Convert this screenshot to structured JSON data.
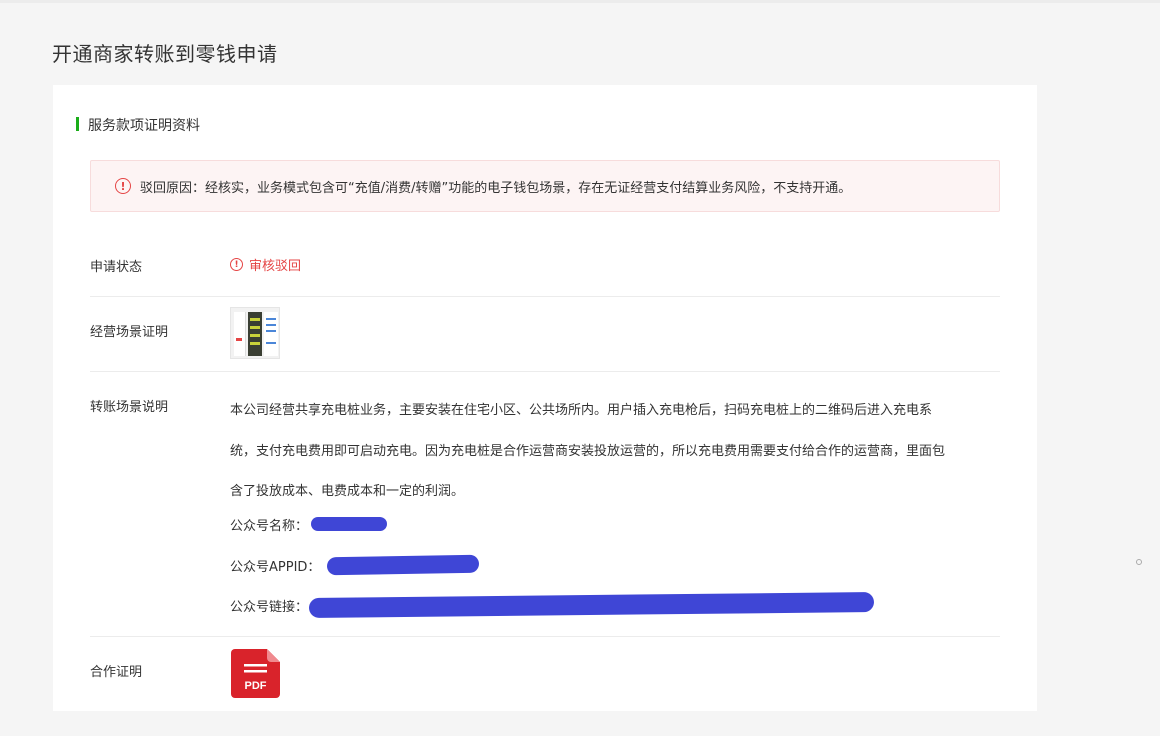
{
  "page": {
    "title": "开通商家转账到零钱申请"
  },
  "section": {
    "title": "服务款项证明资料"
  },
  "alert": {
    "text": "驳回原因：经核实，业务模式包含可“充值/消费/转赠”功能的电子钱包场景，存在无证经营支付结算业务风险，不支持开通。",
    "color": "#e54545"
  },
  "rows": {
    "status_label": "申请状态",
    "status_value": "审核驳回",
    "scene_proof_label": "经营场景证明",
    "transfer_desc_label": "转账场景说明",
    "coop_proof_label": "合作证明"
  },
  "description": {
    "line1": "本公司经营共享充电桩业务，主要安装在住宅小区、公共场所内。用户插入充电枪后，扫码充电桩上的二维码后进入充电系",
    "line2": "统，支付充电费用即可启动充电。因为充电桩是合作运营商安装投放运营的，所以充电费用需要支付给合作的运营商，里面包",
    "line3": "含了投放成本、电费成本和一定的利润。"
  },
  "official_account": {
    "name_label": "公众号名称：",
    "appid_label": "公众号APPID：",
    "link_label": "公众号链接："
  },
  "attachment": {
    "icon": "pdf-icon",
    "label": "PDF"
  },
  "colors": {
    "accent": "#1aad19",
    "error": "#e54545",
    "redaction": "#3f46d6"
  }
}
